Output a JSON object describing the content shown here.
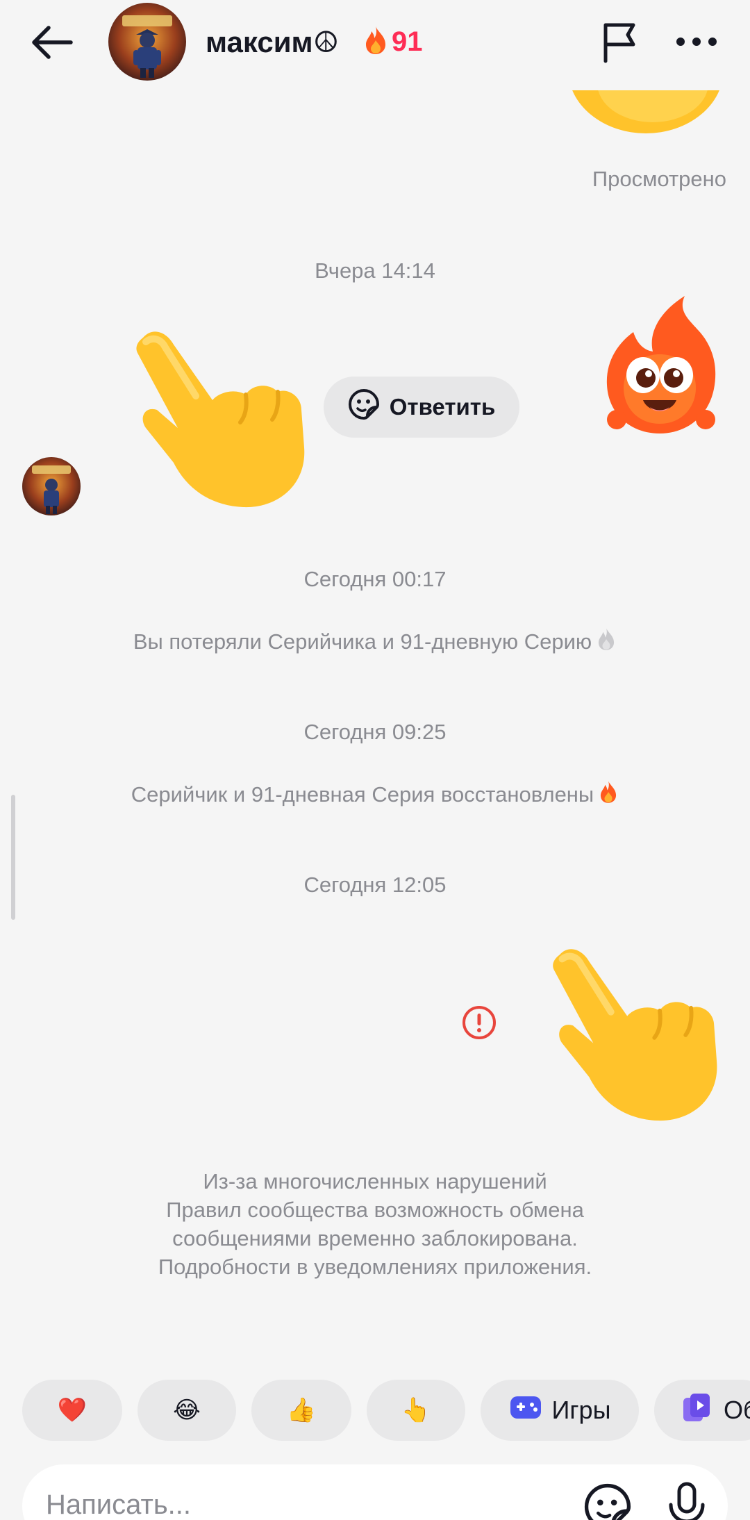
{
  "header": {
    "contact_name": "максим☮",
    "streak_count": "91",
    "icons": [
      "back-arrow-icon",
      "avatar",
      "fire-icon",
      "flag-icon",
      "more-icon"
    ]
  },
  "messages": {
    "seen_label": "Просмотрено",
    "timestamps": [
      "Вчера 14:14",
      "Сегодня 00:17",
      "Сегодня 09:25",
      "Сегодня 12:05"
    ],
    "reply_button": "Ответить",
    "system_lost": "Вы потеряли Серийчика и 91-дневную Серию",
    "system_restored": "Серийчик и 91-дневная Серия восстановлены",
    "blocked_notice": [
      "Из-за многочисленных нарушений",
      "Правил сообщества возможность обмена",
      "сообщениями временно заблокирована.",
      "Подробности в уведомлениях приложения."
    ]
  },
  "quick_replies": {
    "heart": "❤️",
    "laugh": "😂",
    "thumbs": "👍",
    "point": "👆",
    "games_label": "Игры",
    "more_label": "Об"
  },
  "composer": {
    "placeholder": "Написать..."
  },
  "colors": {
    "background": "#f5f5f5",
    "accent": "#fe2c55",
    "muted_text": "#8a8b91",
    "error": "#e8453c",
    "emoji_yellow": "#ffc32b",
    "games_icon": "#4c56f0",
    "streak_flame": "#ff5a1f"
  }
}
